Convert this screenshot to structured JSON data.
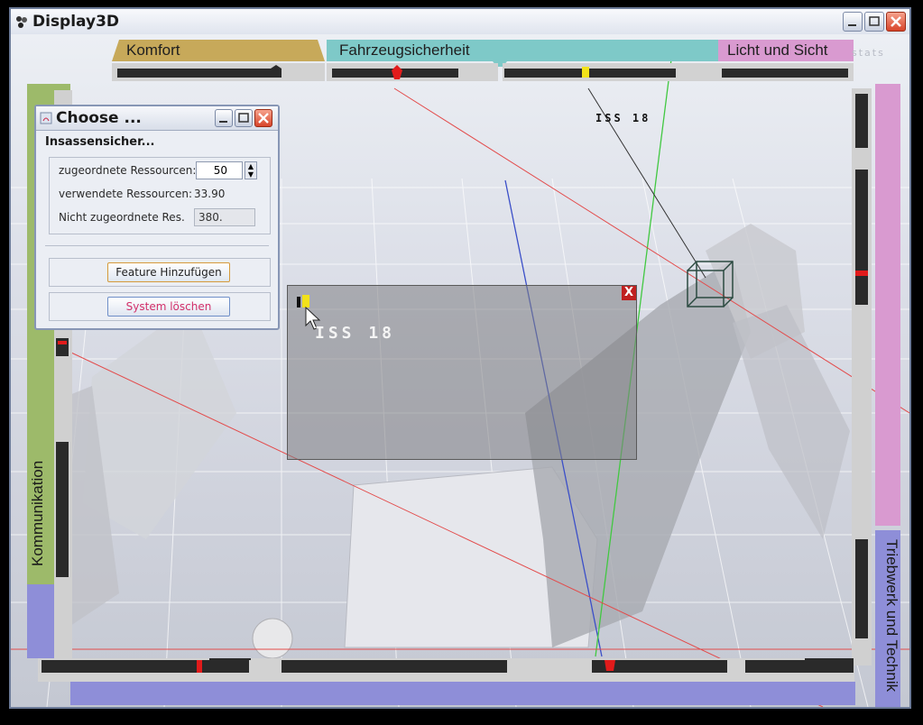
{
  "app": {
    "title": "Display3D"
  },
  "tabs": {
    "komfort": "Komfort",
    "fahrzeugsicherheit": "Fahrzeugsicherheit",
    "licht_und_sicht": "Licht und Sicht",
    "kommunikation": "Kommunikation",
    "triebwerk_und_technik": "Triebwerk und Technik"
  },
  "overlay": {
    "stats": "stats"
  },
  "dialog": {
    "title": "Choose ...",
    "section": "Insassensicher...",
    "assigned_label": "zugeordnete Ressourcen:",
    "assigned_value": "50",
    "used_label": "verwendete Ressourcen:",
    "used_value": "33.90",
    "unassigned_label": "Nicht zugeordnete Res.",
    "unassigned_value": "380.",
    "add_feature": "Feature Hinzufügen",
    "delete_system": "System löschen"
  },
  "scene": {
    "top_label": "ISS 18",
    "panel_label": "ISS 18",
    "panel_close": "X"
  },
  "colors": {
    "komfort": "#c7a95a",
    "fahrzeugsicherheit": "#7ec9c8",
    "licht": "#d98fd0",
    "kommunikation": "#9dba6a",
    "triebwerk": "#8e8ed8",
    "marker_red": "#e11b1b",
    "marker_yellow": "#f2e21a"
  }
}
